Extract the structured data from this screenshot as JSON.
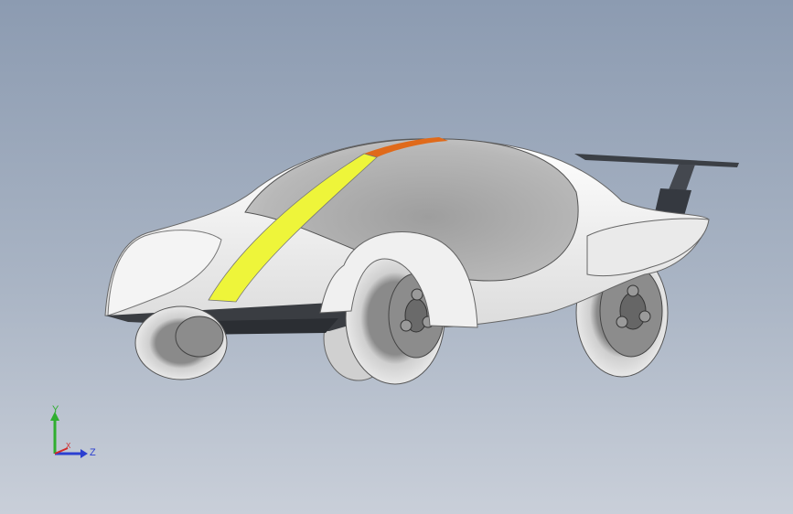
{
  "viewport": {
    "background_top": "#8c9bb1",
    "background_bottom": "#c9cfd9"
  },
  "model": {
    "body_color": "#f2f2f2",
    "canopy_color": "#b7b7b7",
    "stripe_color": "#eef53a",
    "stripe_accent_color": "#e06a1a",
    "wing_color": "#3b3f45",
    "tire_color": "#d9d9d9",
    "rim_color": "#5a5a5a"
  },
  "triad": {
    "y_label": "Y",
    "z_label": "Z",
    "x_label": "X",
    "y_color": "#2fae2f",
    "z_color": "#2b3fd1",
    "x_color": "#d22a2a"
  }
}
